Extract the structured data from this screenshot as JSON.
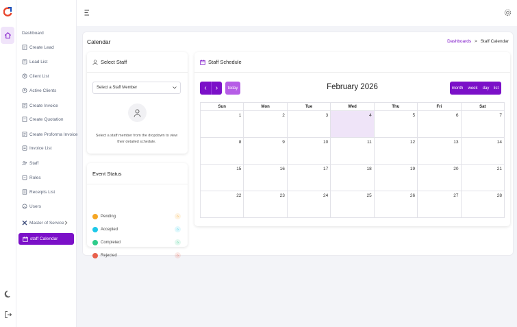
{
  "sidebar": {
    "items": [
      {
        "label": "Dashboard",
        "icon": "none"
      },
      {
        "label": "Create Lead",
        "icon": "form-icon"
      },
      {
        "label": "Lead List",
        "icon": "list-icon"
      },
      {
        "label": "Client List",
        "icon": "client-icon"
      },
      {
        "label": "Active Clients",
        "icon": "client-icon"
      },
      {
        "label": "Create Invoice",
        "icon": "invoice-icon"
      },
      {
        "label": "Create Quotation",
        "icon": "quotation-icon"
      },
      {
        "label": "Create Proforma Invoice",
        "icon": "invoice-icon"
      },
      {
        "label": "Invoice List",
        "icon": "list-icon"
      },
      {
        "label": "Staff",
        "icon": "staff-icon"
      },
      {
        "label": "Roles",
        "icon": "roles-icon"
      },
      {
        "label": "Receipts List",
        "icon": "receipt-icon"
      },
      {
        "label": "Users",
        "icon": "users-icon"
      },
      {
        "label": "Master of Service",
        "icon": "service-icon"
      }
    ],
    "active_label": "staff Calendar"
  },
  "page": {
    "title": "Calendar",
    "breadcrumb_link": "Dashboards",
    "breadcrumb_sep": ">",
    "breadcrumb_current": "Staff Calendar"
  },
  "select_staff": {
    "title": "Select Staff",
    "dropdown_value": "Select a Staff Member",
    "hint": "Select a staff member from the dropdown to view their detailed schedule."
  },
  "event_status": {
    "title": "Event Status",
    "items": [
      {
        "label": "Pending",
        "count": "0",
        "color": "#f5a623"
      },
      {
        "label": "Accepted",
        "count": "0",
        "color": "#1ec8e8"
      },
      {
        "label": "Completed",
        "count": "0",
        "color": "#2ecc8a"
      },
      {
        "label": "Rejected",
        "count": "0",
        "color": "#e8604c"
      }
    ]
  },
  "schedule": {
    "title": "Staff Schedule",
    "prev": "‹",
    "next": "›",
    "today_label": "today",
    "month_title": "February 2026",
    "views": [
      "month",
      "week",
      "day",
      "list"
    ],
    "weekdays": [
      "Sun",
      "Mon",
      "Tue",
      "Wed",
      "Thu",
      "Fri",
      "Sat"
    ],
    "weeks": [
      [
        "1",
        "2",
        "3",
        "4",
        "5",
        "6",
        "7"
      ],
      [
        "8",
        "9",
        "10",
        "11",
        "12",
        "13",
        "14"
      ],
      [
        "15",
        "16",
        "17",
        "18",
        "19",
        "20",
        "21"
      ],
      [
        "22",
        "23",
        "24",
        "25",
        "26",
        "27",
        "28"
      ]
    ],
    "today_date": "4"
  },
  "colors": {
    "accent": "#7b10c8",
    "accent_light": "#b65de6",
    "today_bg": "#efe4f8"
  }
}
